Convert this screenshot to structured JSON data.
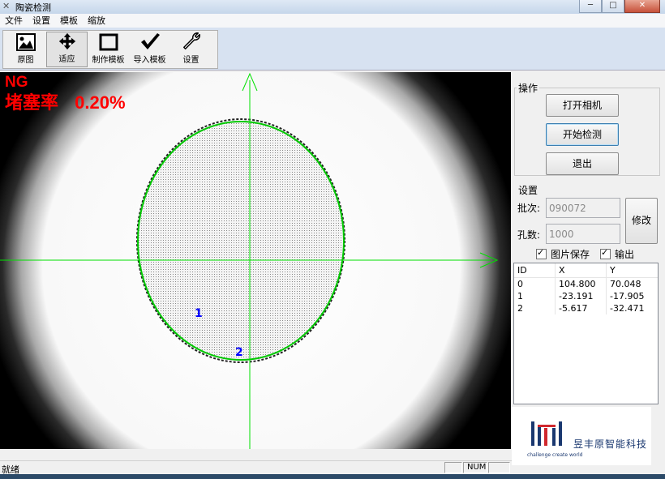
{
  "window": {
    "title": "陶瓷检测",
    "minimize": "─",
    "maximize": "□",
    "close": "✕"
  },
  "menu": [
    "文件",
    "设置",
    "模板",
    "缩放"
  ],
  "toolbar": [
    {
      "label": "原图",
      "icon": "picture-icon"
    },
    {
      "label": "适应",
      "icon": "move-arrows-icon",
      "active": true
    },
    {
      "label": "制作模板",
      "icon": "square-icon"
    },
    {
      "label": "导入模板",
      "icon": "checkmark-icon"
    },
    {
      "label": "设置",
      "icon": "wrench-icon"
    }
  ],
  "result": {
    "status": "NG",
    "rate_label": "堵塞率",
    "rate_value": "0.20%"
  },
  "markers": [
    "1",
    "2"
  ],
  "colors": {
    "ng": "#ff0000",
    "crosshair": "#00e000",
    "contour": "#00c800",
    "marker": "#0000ff"
  },
  "operation": {
    "group_label": "操作",
    "open_camera": "打开相机",
    "start_detect": "开始检测",
    "exit": "退出"
  },
  "settings": {
    "group_label": "设置",
    "batch_label": "批次:",
    "batch_value": "090072",
    "holes_label": "孔数:",
    "holes_value": "1000",
    "modify": "修改",
    "save_image_label": "图片保存",
    "output_label": "输出"
  },
  "table": {
    "headers": [
      "ID",
      "X",
      "Y"
    ],
    "rows": [
      [
        "0",
        "104.800",
        "70.048"
      ],
      [
        "1",
        "-23.191",
        "-17.905"
      ],
      [
        "2",
        "-5.617",
        "-32.471"
      ]
    ]
  },
  "logo": {
    "name": "昱丰原智能科技",
    "tagline": "challenge create world"
  },
  "status": {
    "text": "就绪",
    "num": "NUM"
  }
}
